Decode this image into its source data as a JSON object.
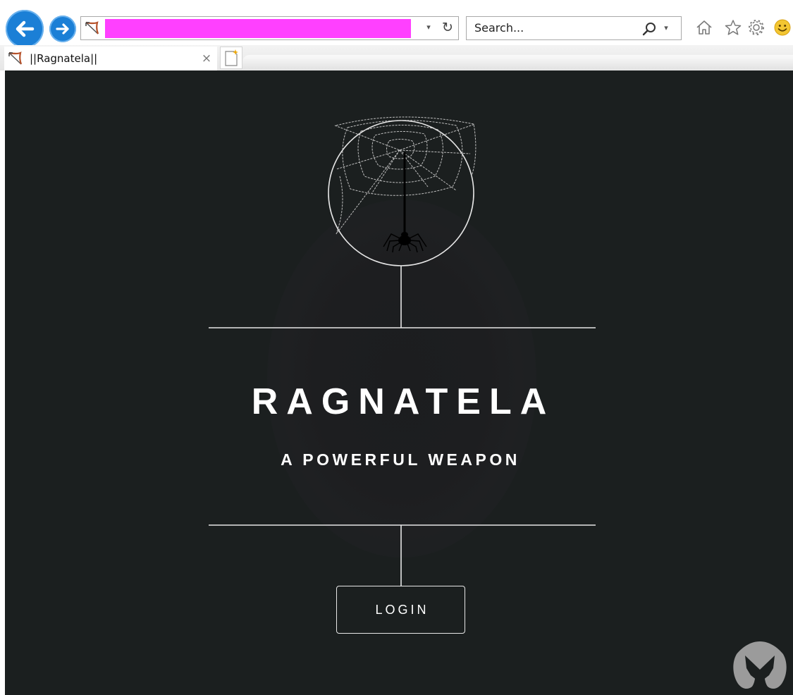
{
  "browser": {
    "search_placeholder": "Search...",
    "tab_title": "||Ragnatela||",
    "tab_close": "×",
    "address_dropdown": "▾",
    "refresh_glyph": "↻",
    "search_dropdown": "▾",
    "address_redacted_color": "#ff40ff",
    "nav_color": "#1b7fd6"
  },
  "page": {
    "title": "RAGNATELA",
    "subtitle": "A POWERFUL WEAPON",
    "login_label": "LOGIN",
    "background_color": "#1b1f1f"
  },
  "icons": {
    "back": "arrow-left-icon",
    "forward": "arrow-right-icon",
    "favicon": "bow-arrow-icon",
    "search": "magnifier-icon",
    "home": "home-icon",
    "favorites": "star-icon",
    "settings": "gear-icon",
    "feedback": "smiley-icon",
    "watermark": "malwarebytes-logo",
    "emblem": "spider-web-icon"
  }
}
